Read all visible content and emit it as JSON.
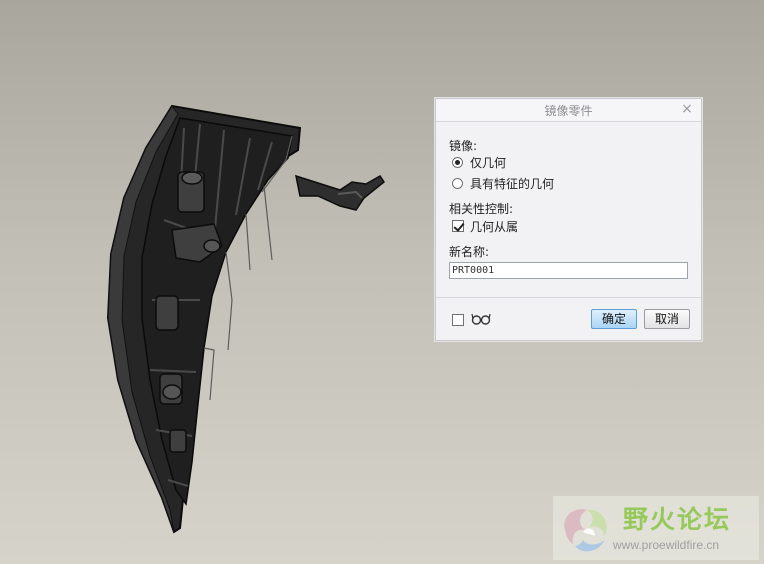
{
  "dialog": {
    "title": "镜像零件",
    "close_glyph": "×",
    "mirror_label": "镜像:",
    "mirror_options": [
      {
        "label": "仅几何",
        "selected": true
      },
      {
        "label": "具有特征的几何",
        "selected": false
      }
    ],
    "dependency_label": "相关性控制:",
    "dependency_option": {
      "label": "几何从属",
      "checked": true
    },
    "new_name_label": "新名称:",
    "new_name_value": "PRT0001",
    "preview_checked": false,
    "preview_icon": "glasses-icon",
    "ok_label": "确定",
    "cancel_label": "取消"
  },
  "watermark": {
    "title": "野火论坛",
    "url": "www.proewildfire.cn"
  },
  "colors": {
    "ok_button": "#a9d5f5",
    "watermark_green": "#97c85a",
    "model": "#2b2b2b"
  }
}
